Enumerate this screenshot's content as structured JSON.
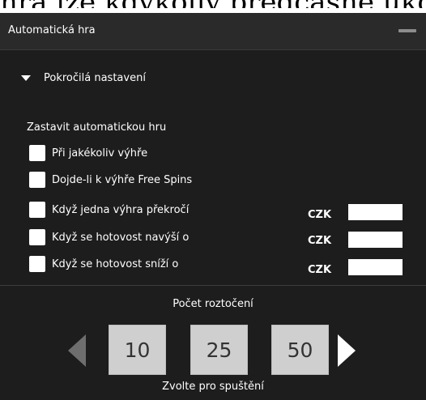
{
  "top_text": "hra lze kdykoliv předčasně ukončit pomo",
  "panel": {
    "title": "Automatická hra"
  },
  "advanced": {
    "label": "Pokročilá nastavení"
  },
  "stop": {
    "label": "Zastavit automatickou hru",
    "options": [
      {
        "label": "Při jakékoliv výhře"
      },
      {
        "label": "Dojde-li k výhře Free Spins"
      },
      {
        "label": "Když jedna výhra překročí",
        "currency": "CZK",
        "value": ""
      },
      {
        "label": "Když se hotovost navýší o",
        "currency": "CZK",
        "value": ""
      },
      {
        "label": "Když se hotovost sníží o",
        "currency": "CZK",
        "value": ""
      }
    ]
  },
  "spins": {
    "label": "Počet roztočení",
    "options": [
      "10",
      "25",
      "50"
    ],
    "hint": "Zvolte pro spuštění"
  }
}
